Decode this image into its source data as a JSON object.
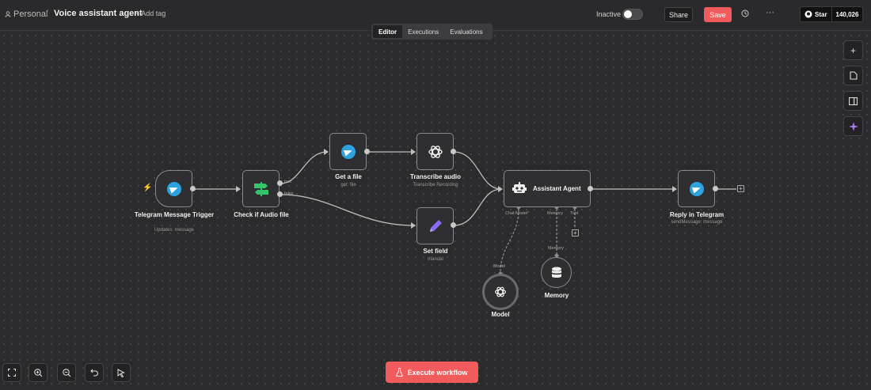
{
  "header": {
    "project": "Personal",
    "workflow_title": "Voice assistant agent",
    "add_tag": "+ Add tag",
    "status_label": "Inactive",
    "share_label": "Share",
    "save_label": "Save",
    "github_star_label": "Star",
    "github_star_count": "140,026"
  },
  "tabs": [
    {
      "label": "Editor",
      "active": true
    },
    {
      "label": "Executions",
      "active": false
    },
    {
      "label": "Evaluations",
      "active": false
    }
  ],
  "nodes": {
    "trigger": {
      "label": "Telegram Message Trigger",
      "sub": "Updates: message",
      "icon": "telegram-icon"
    },
    "check_audio": {
      "label": "Check if Audio file",
      "sub": "",
      "icon": "switch-icon",
      "outputs": [
        "true",
        "false"
      ]
    },
    "get_file": {
      "label": "Get a file",
      "sub": "get: file",
      "icon": "telegram-icon"
    },
    "transcribe": {
      "label": "Transcribe audio",
      "sub": "Transcribe Recording",
      "icon": "openai-icon"
    },
    "set_field": {
      "label": "Set field",
      "sub": "manual",
      "icon": "pencil-icon"
    },
    "agent": {
      "label": "Assistant Agent",
      "sub": "",
      "icon": "robot-icon",
      "ports": [
        "Chat Model",
        "Memory",
        "Tool"
      ]
    },
    "model": {
      "label": "Model",
      "port": "Model",
      "icon": "openai-icon"
    },
    "memory": {
      "label": "Memory",
      "port": "Memory",
      "icon": "database-icon"
    },
    "reply": {
      "label": "Reply in Telegram",
      "sub": "sendMessage: message",
      "icon": "telegram-icon"
    }
  },
  "side_buttons": [
    "plus-icon",
    "sticky-note-icon",
    "panel-icon",
    "sparkle-icon"
  ],
  "controls": [
    "fit-view-icon",
    "zoom-in-icon",
    "zoom-out-icon",
    "undo-icon",
    "pointer-icon"
  ],
  "execute_label": "Execute workflow",
  "colors": {
    "accent": "#f15b5b",
    "telegram": "#2aa3e0",
    "switch": "#35c46a",
    "pencil": "#8b6cf0"
  }
}
